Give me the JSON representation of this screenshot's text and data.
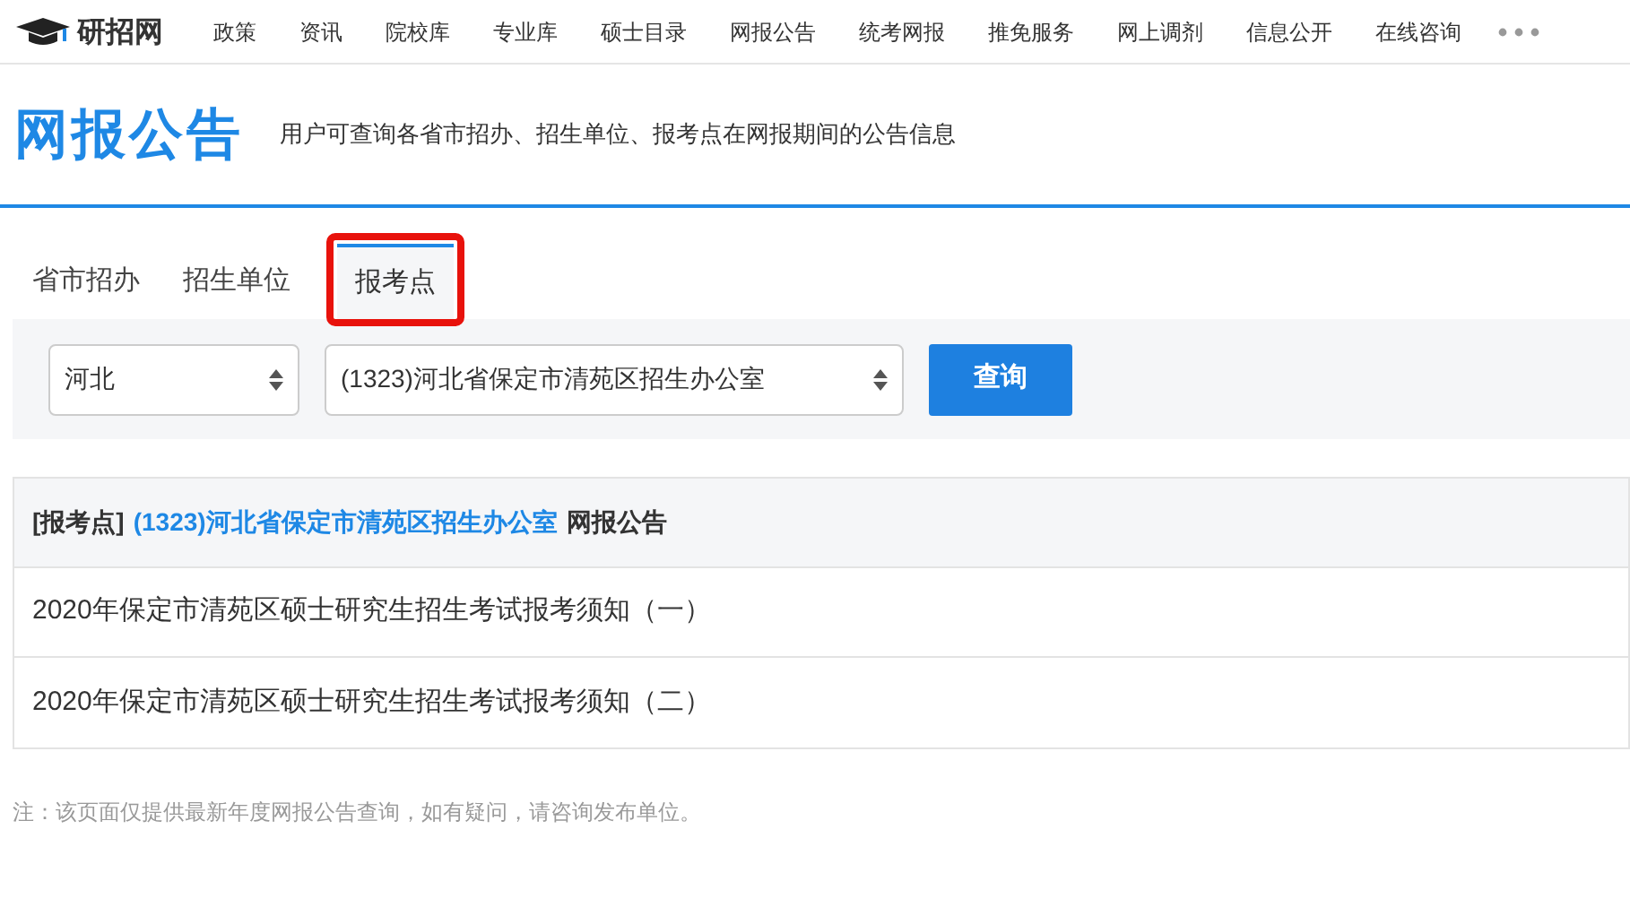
{
  "logo": {
    "text": "研招网"
  },
  "nav": [
    "政策",
    "资讯",
    "院校库",
    "专业库",
    "硕士目录",
    "网报公告",
    "统考网报",
    "推免服务",
    "网上调剂",
    "信息公开",
    "在线咨询"
  ],
  "header": {
    "title": "网报公告",
    "subtitle": "用户可查询各省市招办、招生单位、报考点在网报期间的公告信息"
  },
  "tabs": [
    {
      "label": "省市招办",
      "selected": false,
      "highlighted": false
    },
    {
      "label": "招生单位",
      "selected": false,
      "highlighted": false
    },
    {
      "label": "报考点",
      "selected": true,
      "highlighted": true
    }
  ],
  "filters": {
    "province": "河北",
    "site": "(1323)河北省保定市清苑区招生办公室",
    "button": "查询"
  },
  "table": {
    "heading": {
      "prefix": "[报考点]",
      "name": "(1323)河北省保定市清苑区招生办公室",
      "suffix": "网报公告"
    },
    "rows": [
      "2020年保定市清苑区硕士研究生招生考试报考须知（一）",
      "2020年保定市清苑区硕士研究生招生考试报考须知（二）"
    ]
  },
  "note": "注：该页面仅提供最新年度网报公告查询，如有疑问，请咨询发布单位。"
}
